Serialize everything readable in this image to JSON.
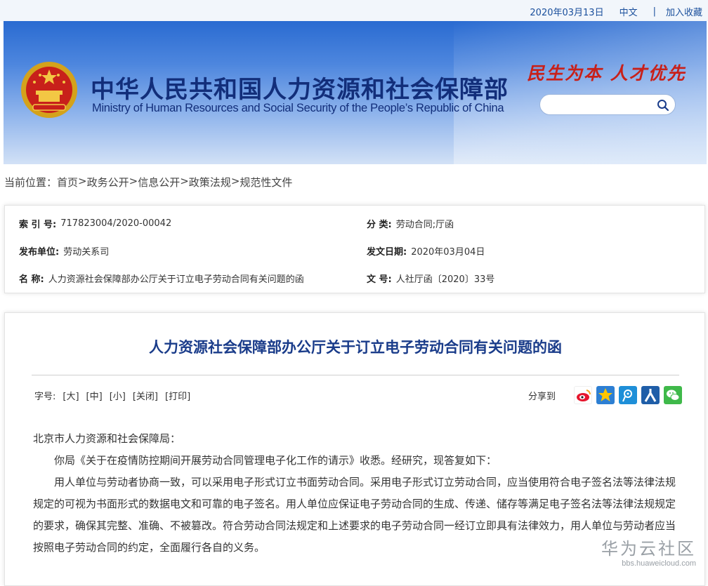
{
  "topbar": {
    "date": "2020年03月13日",
    "lang": "中文",
    "sep": "|",
    "favorite": "加入收藏"
  },
  "header": {
    "title_cn": "中华人民共和国人力资源和社会保障部",
    "title_en": "Ministry of Human Resources and Social Security of the People’s Republic of China",
    "slogan": "民生为本 人才优先",
    "search": {
      "value": "",
      "placeholder": ""
    }
  },
  "breadcrumb": {
    "label": "当前位置：",
    "items": [
      "首页",
      "政务公开",
      "信息公开",
      "政策法规",
      "规范性文件"
    ],
    "separator": ">"
  },
  "meta": {
    "index_label": "索 引 号:",
    "index_value": "717823004/2020-00042",
    "category_label": "分  类:",
    "category_value": "劳动合同;厅函",
    "issuer_label": "发布单位:",
    "issuer_value": "劳动关系司",
    "date_label": "发文日期:",
    "date_value": "2020年03月04日",
    "name_label": "名  称:",
    "name_value": "人力资源社会保障部办公厅关于订立电子劳动合同有关问题的函",
    "docno_label": "文  号:",
    "docno_value": "人社厅函〔2020〕33号"
  },
  "article": {
    "title": "人力资源社会保障部办公厅关于订立电子劳动合同有关问题的函",
    "tools_label": "字号:",
    "tools": [
      "[大]",
      "[中]",
      "[小]",
      "[关闭]",
      "[打印]"
    ],
    "share_label": "分享到",
    "share_icons": [
      "weibo-icon",
      "qzone-icon",
      "tencent-weibo-icon",
      "renren-icon",
      "wechat-icon"
    ],
    "salutation": "北京市人力资源和社会保障局：",
    "para1": "你局《关于在疫情防控期间开展劳动合同管理电子化工作的请示》收悉。经研究，现答复如下：",
    "para2": "用人单位与劳动者协商一致，可以采用电子形式订立书面劳动合同。采用电子形式订立劳动合同，应当使用符合电子签名法等法律法规规定的可视为书面形式的数据电文和可靠的电子签名。用人单位应保证电子劳动合同的生成、传递、储存等满足电子签名法等法律法规规定的要求，确保其完整、准确、不被篡改。符合劳动合同法规定和上述要求的电子劳动合同一经订立即具有法律效力，用人单位与劳动者应当按照电子劳动合同的约定，全面履行各自的义务。"
  },
  "watermark": {
    "line1": "华为云社区",
    "line2": "bbs.huaweicloud.com"
  },
  "colors": {
    "banner_blue": "#2a6bd1",
    "title_navy": "#122e7a",
    "slogan_red": "#c8201a",
    "article_title": "#1a3c8a"
  }
}
